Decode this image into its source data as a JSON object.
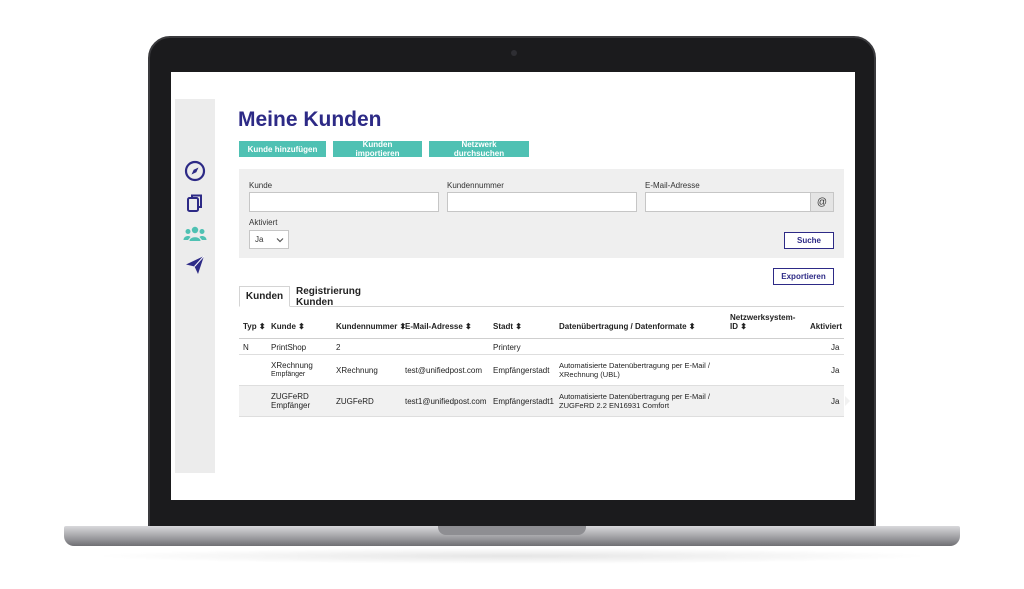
{
  "page": {
    "title": "Meine Kunden"
  },
  "sidebar": {
    "items": [
      {
        "icon": "compass-icon"
      },
      {
        "icon": "copy-documents-icon"
      },
      {
        "icon": "users-icon"
      },
      {
        "icon": "paper-plane-icon"
      }
    ]
  },
  "actions": {
    "add_customer": "Kunde hinzufügen",
    "import_customers": "Kunden importieren",
    "search_network": "Netzwerk durchsuchen"
  },
  "filter": {
    "customer_label": "Kunde",
    "customer_value": "",
    "number_label": "Kundennummer",
    "number_value": "",
    "email_label": "E-Mail-Adresse",
    "email_value": "",
    "email_button": "@",
    "active_label": "Aktiviert",
    "active_value": "Ja",
    "search_button": "Suche"
  },
  "export_button": "Exportieren",
  "tabs": [
    {
      "label": "Kunden",
      "active": true
    },
    {
      "label": "Registrierung Kunden",
      "active": false
    }
  ],
  "table": {
    "columns": [
      "Typ ⬍",
      "Kunde ⬍",
      "Kundennummer ⬍",
      "E-Mail-Adresse ⬍",
      "Stadt ⬍",
      "Datenübertragung / Datenformate ⬍",
      "Netzwerksystem-",
      "ID ⬍",
      "Aktiviert"
    ],
    "rows": [
      {
        "typ": "N",
        "kunde1": "PrintShop",
        "kunde2": "",
        "nummer": "2",
        "email": "",
        "stadt": "Printery",
        "daten1": "",
        "daten2": "",
        "netz": "",
        "aktiv": "Ja"
      },
      {
        "typ": "",
        "kunde1": "XRechnung",
        "kunde2": "Empfänger",
        "nummer": "XRechnung",
        "email": "test@unifiedpost.com",
        "stadt": "Empfängerstadt",
        "daten1": "Automatisierte Datenübertragung per E-Mail /",
        "daten2": "XRechnung (UBL)",
        "netz": "",
        "aktiv": "Ja"
      },
      {
        "typ": "",
        "kunde1": "ZUGFeRD",
        "kunde2": "Empfänger",
        "nummer": "ZUGFeRD",
        "email": "test1@unifiedpost.com",
        "stadt": "Empfängerstadt1",
        "daten1": "Automatisierte Datenübertragung per E-Mail /",
        "daten2": "ZUGFeRD 2.2 EN16931 Comfort",
        "netz": "",
        "aktiv": "Ja"
      }
    ]
  },
  "colors": {
    "brand": "#2d2a86",
    "accent": "#4fc1b3"
  }
}
